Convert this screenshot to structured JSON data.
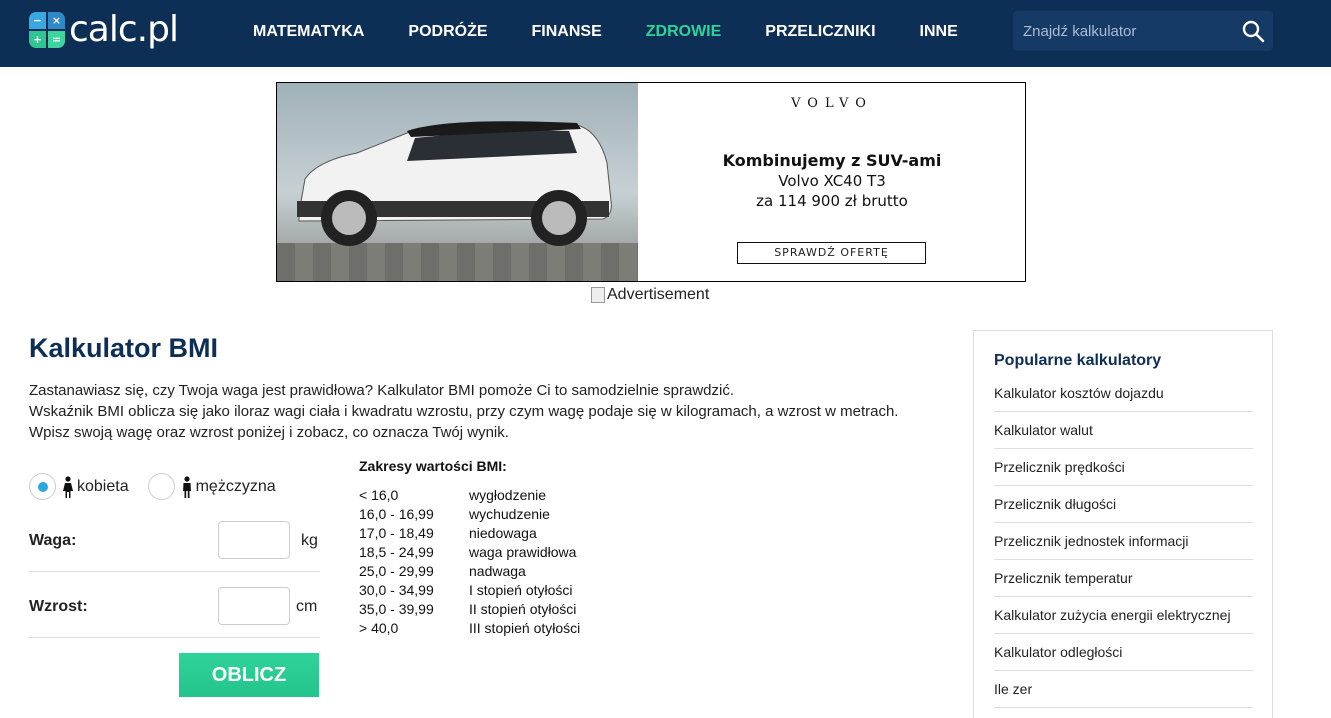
{
  "header": {
    "logo_text": "calc.pl",
    "logo_symbols": [
      "−",
      "×",
      "+",
      "="
    ],
    "nav": [
      {
        "label": "MATEMATYKA",
        "active": false
      },
      {
        "label": "PODRÓŻE",
        "active": false
      },
      {
        "label": "FINANSE",
        "active": false
      },
      {
        "label": "ZDROWIE",
        "active": true
      },
      {
        "label": "PRZELICZNIKI",
        "active": false
      },
      {
        "label": "INNE",
        "active": false
      }
    ],
    "search_placeholder": "Znajdź kalkulator",
    "colors": {
      "background": "#0d2e55",
      "active": "#2fd39a"
    }
  },
  "ad": {
    "brand": "VOLVO",
    "headline": "Kombinujemy z SUV-ami",
    "line2": "Volvo XC40 T3",
    "line3": "za 114 900 zł brutto",
    "cta": "SPRAWDŹ OFERTĘ",
    "alt_text": "Advertisement"
  },
  "main": {
    "title": "Kalkulator BMI",
    "intro": [
      "Zastanawiasz się, czy Twoja waga jest prawidłowa? Kalkulator BMI pomoże Ci to samodzielnie sprawdzić.",
      "Wskaźnik BMI oblicza się jako iloraz wagi ciała i kwadratu wzrostu, przy czym wagę podaje się w kilogramach, a wzrost w metrach.",
      "Wpisz swoją wagę oraz wzrost poniżej i zobacz, co oznacza Twój wynik."
    ],
    "gender": {
      "female_label": "kobieta",
      "male_label": "mężczyzna",
      "selected": "kobieta"
    },
    "weight": {
      "label": "Waga:",
      "unit": "kg",
      "value": ""
    },
    "height": {
      "label": "Wzrost:",
      "unit": "cm",
      "value": ""
    },
    "submit_label": "OBLICZ"
  },
  "ranges": {
    "heading": "Zakresy wartości BMI:",
    "rows": [
      {
        "range": "< 16,0",
        "label": "wygłodzenie"
      },
      {
        "range": "16,0 - 16,99",
        "label": "wychudzenie"
      },
      {
        "range": "17,0 - 18,49",
        "label": "niedowaga"
      },
      {
        "range": "18,5 - 24,99",
        "label": "waga prawidłowa"
      },
      {
        "range": "25,0 - 29,99",
        "label": "nadwaga"
      },
      {
        "range": "30,0 - 34,99",
        "label": "I stopień otyłości"
      },
      {
        "range": "35,0 - 39,99",
        "label": "II stopień otyłości"
      },
      {
        "range": "> 40,0",
        "label": "III stopień otyłości"
      }
    ]
  },
  "sidebar": {
    "title": "Popularne kalkulatory",
    "items": [
      {
        "label": "Kalkulator kosztów dojazdu"
      },
      {
        "label": "Kalkulator walut"
      },
      {
        "label": "Przelicznik prędkości"
      },
      {
        "label": "Przelicznik długości"
      },
      {
        "label": "Przelicznik jednostek informacji"
      },
      {
        "label": "Przelicznik temperatur"
      },
      {
        "label": "Kalkulator zużycia energii elektrycznej"
      },
      {
        "label": "Kalkulator odległości"
      },
      {
        "label": "Ile zer"
      }
    ]
  }
}
